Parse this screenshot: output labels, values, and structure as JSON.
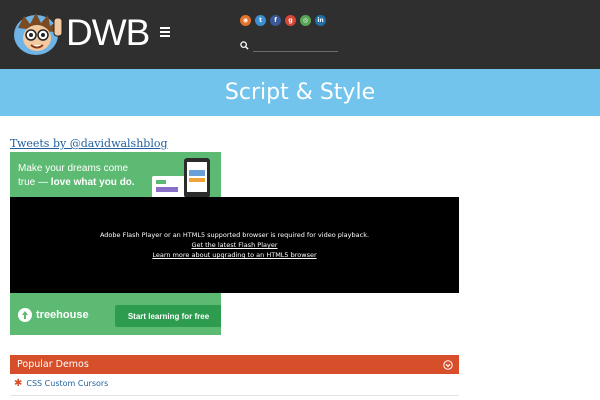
{
  "header": {
    "logo_text": "DWB",
    "search": {
      "placeholder": "",
      "value": ""
    },
    "social_icons": [
      {
        "name": "rss-icon",
        "glyph": "◉",
        "color": "#e5722c"
      },
      {
        "name": "twitter-icon",
        "glyph": "t",
        "color": "#3b8fd0"
      },
      {
        "name": "facebook-icon",
        "glyph": "f",
        "color": "#3b5998"
      },
      {
        "name": "google-plus-icon",
        "glyph": "g",
        "color": "#d34836"
      },
      {
        "name": "github-icon",
        "glyph": "◎",
        "color": "#57a557"
      },
      {
        "name": "linkedin-icon",
        "glyph": "in",
        "color": "#1d6fa6"
      }
    ]
  },
  "banner": {
    "title": "Script & Style"
  },
  "sidebar": {
    "tweets_link": "Tweets by @davidwalshblog",
    "ad": {
      "headline_part1": "Make your dreams come true — ",
      "headline_part2": "love what you do.",
      "brand": "treehouse",
      "cta": "Start learning for free"
    }
  },
  "video": {
    "message": "Adobe Flash Player or an HTML5 supported browser is required for video playback.",
    "link1": "Get the latest Flash Player",
    "link2": "Learn more about upgrading to an HTML5 browser"
  },
  "popular_demos": {
    "title": "Popular Demos",
    "items": [
      {
        "label": "CSS Custom Cursors"
      }
    ]
  },
  "colors": {
    "header_bg": "#2f2f2f",
    "banner_bg": "#72c4ec",
    "ad_bg": "#5dba73",
    "demos_header_bg": "#d64f2a",
    "link": "#1f5f9e"
  }
}
